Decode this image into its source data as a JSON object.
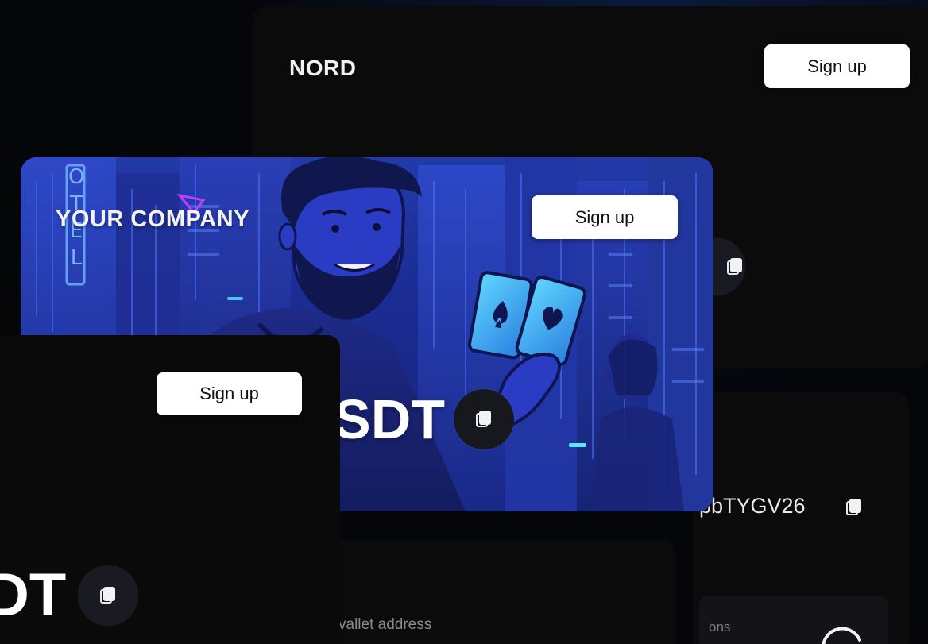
{
  "nord_card": {
    "brand": "NORD",
    "signup_label": "Sign up"
  },
  "hero_card": {
    "brand": "YOUR COMPANY",
    "signup_label": "Sign up",
    "ticker_fragment": "SDT",
    "neon_sign": "OTEL"
  },
  "left_card": {
    "signup_label": "Sign up",
    "ticker_fragment": "DT"
  },
  "right_card": {
    "address_fragment": "pbTYGV26",
    "secondary_label": "ons"
  },
  "bottom_card": {
    "field_label": "vallet address"
  },
  "colors": {
    "hero_bg": "#1e2ea8",
    "accent_cyan": "#3fc4ff",
    "accent_pink": "#c03cff",
    "panel": "#0a0a0a"
  },
  "icons": [
    "copy-icon",
    "spade-card-icon",
    "heart-card-icon",
    "loading-spinner-icon"
  ]
}
